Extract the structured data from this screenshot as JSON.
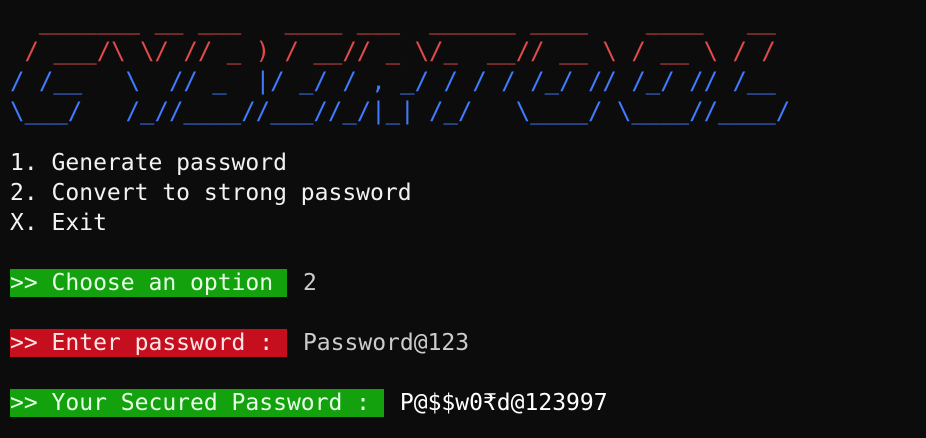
{
  "banner": {
    "red_lines": [
      "  _______ __ ___   ____ ___  ______ ____    ____   __",
      " / ___/\\ \\/ // _ ) / __// _ \\/_  __// __ \\ / __ \\ / /"
    ],
    "blue_lines": [
      "/ /__   \\  // _  |/ _/ / , _/ / / / /_/ // /_/ // /__",
      "\\___/   /_//____//___//_/|_| /_/   \\____/ \\____//____/"
    ],
    "colors": {
      "top": "#e04a4a",
      "bottom": "#3f7bff"
    }
  },
  "menu": {
    "items": [
      "1. Generate password",
      "2. Convert to strong password",
      "X. Exit"
    ]
  },
  "prompts": {
    "choose_label": ">> Choose an option ",
    "choose_value": "2",
    "enter_label": ">> Enter password : ",
    "enter_value": "Password@123",
    "result_label": ">> Your Secured Password : ",
    "result_value": "P@$$w0₹d@123997"
  },
  "colors": {
    "background": "#0c0c0c",
    "green_highlight": "#13a10e",
    "red_highlight": "#c50f1f",
    "text": "#f2f2f2"
  }
}
